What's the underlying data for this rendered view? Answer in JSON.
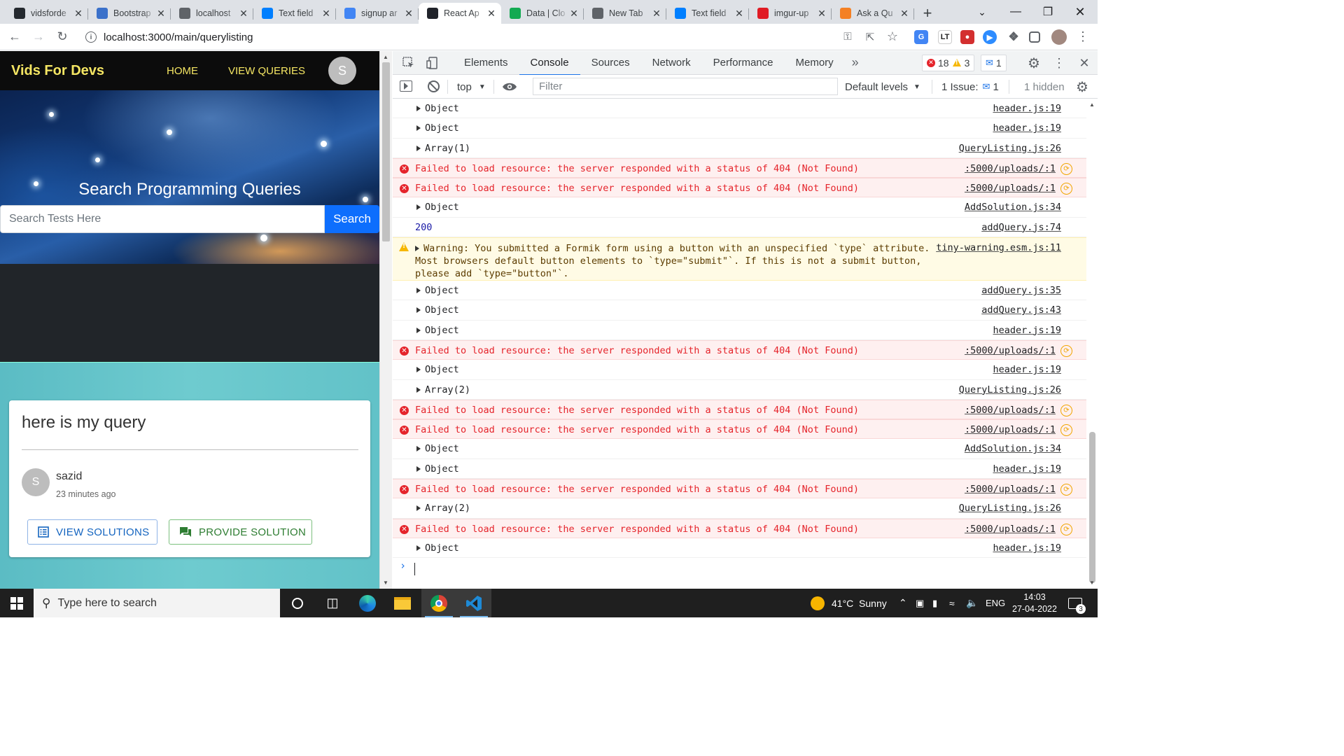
{
  "browser": {
    "tabs": [
      {
        "title": "vidsforde",
        "icon": "github-icon",
        "color": "#24292f"
      },
      {
        "title": "Bootstrap",
        "icon": "mdb-icon",
        "color": "#3b71ca"
      },
      {
        "title": "localhost",
        "icon": "globe-icon",
        "color": "#5f6368"
      },
      {
        "title": "Text field",
        "icon": "mui-icon",
        "color": "#007fff"
      },
      {
        "title": "signup ar",
        "icon": "google-icon",
        "color": "#4285f4"
      },
      {
        "title": "React Ap",
        "icon": "react-icon",
        "color": "#20232a"
      },
      {
        "title": "Data | Clo",
        "icon": "mongodb-icon",
        "color": "#13aa52"
      },
      {
        "title": "New Tab",
        "icon": "chrome-icon",
        "color": "#5f6368"
      },
      {
        "title": "Text field",
        "icon": "mui-icon",
        "color": "#007fff"
      },
      {
        "title": "imgur-up",
        "icon": "imgur-icon",
        "color": "#e01b24"
      },
      {
        "title": "Ask a Qu",
        "icon": "stackoverflow-icon",
        "color": "#f48024"
      }
    ],
    "active_tab": 5,
    "url": "localhost:3000/main/querylisting"
  },
  "app": {
    "brand": "Vids For Devs",
    "nav": {
      "home": "HOME",
      "view_queries": "VIEW QUERIES",
      "avatar_initial": "S"
    },
    "hero_title": "Search Programming Queries",
    "search": {
      "placeholder": "Search Tests Here",
      "button": "Search"
    },
    "query_card": {
      "title": "here is my query",
      "user_initial": "S",
      "user_name": "sazid",
      "time_ago": "23 minutes ago",
      "view_solutions": "VIEW SOLUTIONS",
      "provide_solution": "PROVIDE SOLUTION"
    }
  },
  "devtools": {
    "tabs": [
      "Elements",
      "Console",
      "Sources",
      "Network",
      "Performance",
      "Memory"
    ],
    "active_tab": "Console",
    "error_count": "18",
    "warning_count": "3",
    "message_count": "1",
    "context": "top",
    "filter_placeholder": "Filter",
    "levels": "Default levels",
    "issues_label": "1 Issue:",
    "issues_count": "1",
    "hidden": "1 hidden",
    "console_rows": [
      {
        "type": "obj",
        "text": "Object",
        "src": "header.js:19"
      },
      {
        "type": "obj",
        "text": "Object",
        "src": "header.js:19"
      },
      {
        "type": "obj",
        "text": "Array(1)",
        "src": "QueryListing.js:26"
      },
      {
        "type": "err",
        "text": "Failed to load resource: the server responded with a status of 404 (Not Found)",
        "src": ":5000/uploads/:1"
      },
      {
        "type": "err",
        "text": "Failed to load resource: the server responded with a status of 404 (Not Found)",
        "src": ":5000/uploads/:1"
      },
      {
        "type": "obj",
        "text": "Object",
        "src": "AddSolution.js:34"
      },
      {
        "type": "num",
        "text": "200",
        "src": "addQuery.js:74"
      },
      {
        "type": "warn",
        "text": "Warning: You submitted a Formik form using a button with an unspecified `type` attribute.  Most browsers default button elements to `type=\"submit\"`. If this is not a submit button, please add `type=\"button\"`.",
        "src": "tiny-warning.esm.js:11"
      },
      {
        "type": "obj",
        "text": "Object",
        "src": "addQuery.js:35"
      },
      {
        "type": "obj",
        "text": "Object",
        "src": "addQuery.js:43"
      },
      {
        "type": "obj",
        "text": "Object",
        "src": "header.js:19"
      },
      {
        "type": "err",
        "text": "Failed to load resource: the server responded with a status of 404 (Not Found)",
        "src": ":5000/uploads/:1"
      },
      {
        "type": "obj",
        "text": "Object",
        "src": "header.js:19"
      },
      {
        "type": "obj",
        "text": "Array(2)",
        "src": "QueryListing.js:26"
      },
      {
        "type": "err",
        "text": "Failed to load resource: the server responded with a status of 404 (Not Found)",
        "src": ":5000/uploads/:1"
      },
      {
        "type": "err",
        "text": "Failed to load resource: the server responded with a status of 404 (Not Found)",
        "src": ":5000/uploads/:1"
      },
      {
        "type": "obj",
        "text": "Object",
        "src": "AddSolution.js:34"
      },
      {
        "type": "obj",
        "text": "Object",
        "src": "header.js:19"
      },
      {
        "type": "err",
        "text": "Failed to load resource: the server responded with a status of 404 (Not Found)",
        "src": ":5000/uploads/:1"
      },
      {
        "type": "obj",
        "text": "Array(2)",
        "src": "QueryListing.js:26"
      },
      {
        "type": "err",
        "text": "Failed to load resource: the server responded with a status of 404 (Not Found)",
        "src": ":5000/uploads/:1"
      },
      {
        "type": "obj",
        "text": "Object",
        "src": "header.js:19"
      }
    ]
  },
  "taskbar": {
    "search_placeholder": "Type here to search",
    "weather": "41°C  Sunny",
    "language": "ENG",
    "time": "14:03",
    "date": "27-04-2022",
    "notifications": "3"
  }
}
